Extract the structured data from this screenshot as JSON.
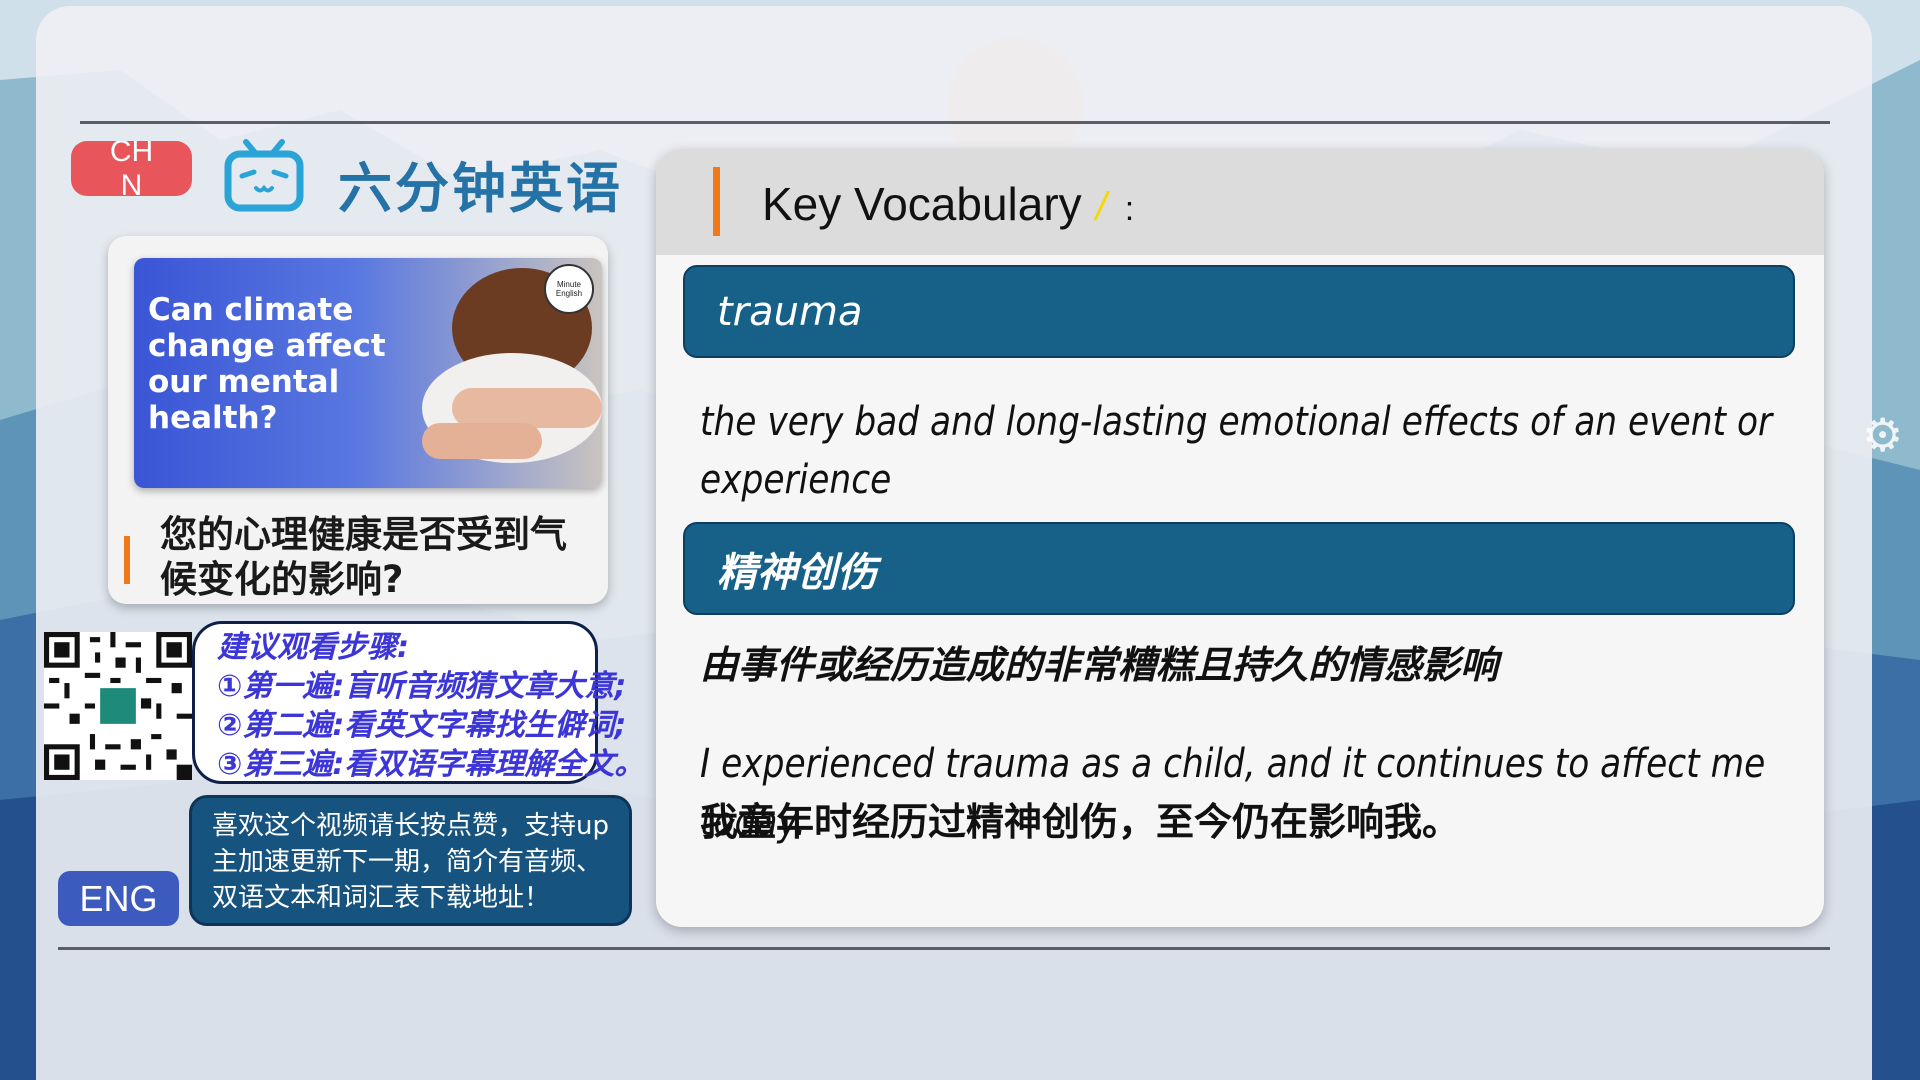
{
  "lang_toggle": {
    "chn": "CHN",
    "eng": "ENG"
  },
  "brand": {
    "title": "六分钟英语",
    "icon": "tv-face-icon"
  },
  "episode": {
    "thumbnail_text": "Can climate change affect our mental health?",
    "thumbnail_badge": "Minute English",
    "caption": "您的心理健康是否受到气候变化的影响?"
  },
  "steps": {
    "title": "建议观看步骤:",
    "items": [
      "①第一遍:盲听音频猜文章大意;",
      "②第二遍:看英文字幕找生僻词;",
      "③第三遍:看双语字幕理解全文。"
    ]
  },
  "promo": "喜欢这个视频请长按点赞，支持up主加速更新下一期，简介有音频、双语文本和词汇表下载地址！",
  "vocab": {
    "heading": "Key Vocabulary",
    "cursor": "/",
    "colon": ":",
    "term_en": "trauma",
    "definition_en": "the very bad and long-lasting emotional effects of an event or experience",
    "term_zh": "精神创伤",
    "definition_zh": "由事件或经历造成的非常糟糕且持久的情感影响",
    "example_en": "I experienced trauma as a child, and it continues to affect me today.",
    "example_zh": "我童年时经历过精神创伤，至今仍在影响我。"
  },
  "colors": {
    "accent_orange": "#f07a1a",
    "term_bar": "#176088",
    "chn_pill": "#e8555a",
    "eng_pill": "#3d5bbf",
    "brand_blue": "#2472a6"
  }
}
